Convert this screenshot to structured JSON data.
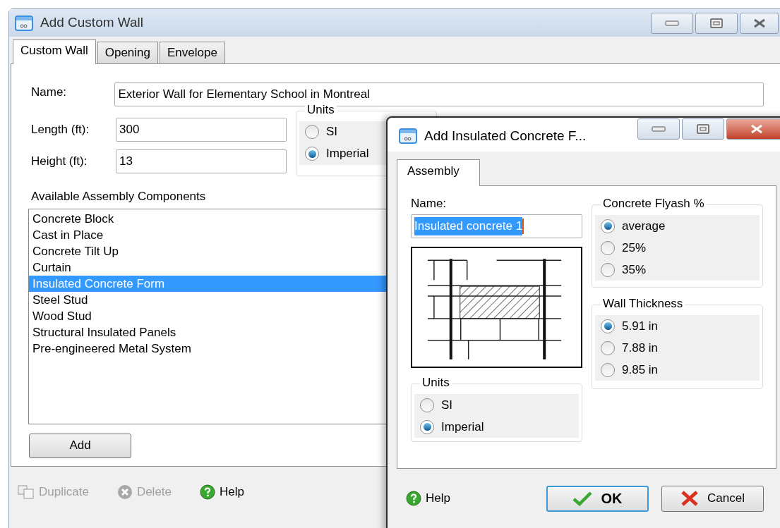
{
  "main_window": {
    "title": "Add Custom Wall",
    "tabs": [
      {
        "label": "Custom Wall",
        "selected": true
      },
      {
        "label": "Opening",
        "selected": false
      },
      {
        "label": "Envelope",
        "selected": false
      }
    ],
    "name_label": "Name:",
    "name_value": "Exterior Wall for Elementary School in Montreal",
    "length_label": "Length (ft):",
    "length_value": "300",
    "height_label": "Height (ft):",
    "height_value": "13",
    "units": {
      "title": "Units",
      "options": [
        {
          "label": "SI",
          "selected": false
        },
        {
          "label": "Imperial",
          "selected": true
        }
      ]
    },
    "components_label": "Available Assembly Components",
    "components": [
      {
        "label": "Concrete Block",
        "selected": false
      },
      {
        "label": "Cast in Place",
        "selected": false
      },
      {
        "label": "Concrete Tilt Up",
        "selected": false
      },
      {
        "label": "Curtain",
        "selected": false
      },
      {
        "label": "Insulated Concrete Form",
        "selected": true
      },
      {
        "label": "Steel Stud",
        "selected": false
      },
      {
        "label": "Wood Stud",
        "selected": false
      },
      {
        "label": "Structural Insulated Panels",
        "selected": false
      },
      {
        "label": "Pre-engineered Metal System",
        "selected": false
      }
    ],
    "add_button": "Add",
    "footer": [
      {
        "kind": "duplicate",
        "label": "Duplicate",
        "disabled": true
      },
      {
        "kind": "delete",
        "label": "Delete",
        "disabled": true
      },
      {
        "kind": "help",
        "label": "Help",
        "disabled": false
      }
    ]
  },
  "dialog": {
    "title": "Add Insulated Concrete F...",
    "tabs": [
      {
        "label": "Assembly",
        "selected": true
      }
    ],
    "name_label": "Name:",
    "name_value": "Insulated concrete 1",
    "units": {
      "title": "Units",
      "options": [
        {
          "label": "SI",
          "selected": false
        },
        {
          "label": "Imperial",
          "selected": true
        }
      ]
    },
    "flyash": {
      "title": "Concrete Flyash %",
      "options": [
        {
          "label": "average",
          "selected": true
        },
        {
          "label": "25%",
          "selected": false
        },
        {
          "label": "35%",
          "selected": false
        }
      ]
    },
    "thickness": {
      "title": "Wall Thickness",
      "options": [
        {
          "label": "5.91 in",
          "selected": true
        },
        {
          "label": "7.88 in",
          "selected": false
        },
        {
          "label": "9.85 in",
          "selected": false
        }
      ]
    },
    "help": "Help",
    "buttons": [
      {
        "kind": "ok",
        "label": "OK"
      },
      {
        "kind": "cancel",
        "label": "Cancel"
      }
    ]
  }
}
